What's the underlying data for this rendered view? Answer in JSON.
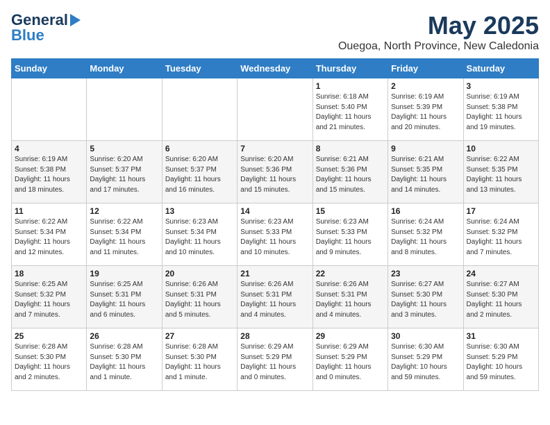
{
  "logo": {
    "line1": "General",
    "line2": "Blue"
  },
  "title": "May 2025",
  "subtitle": "Ouegoa, North Province, New Caledonia",
  "days_of_week": [
    "Sunday",
    "Monday",
    "Tuesday",
    "Wednesday",
    "Thursday",
    "Friday",
    "Saturday"
  ],
  "weeks": [
    [
      {
        "day": "",
        "info": ""
      },
      {
        "day": "",
        "info": ""
      },
      {
        "day": "",
        "info": ""
      },
      {
        "day": "",
        "info": ""
      },
      {
        "day": "1",
        "info": "Sunrise: 6:18 AM\nSunset: 5:40 PM\nDaylight: 11 hours\nand 21 minutes."
      },
      {
        "day": "2",
        "info": "Sunrise: 6:19 AM\nSunset: 5:39 PM\nDaylight: 11 hours\nand 20 minutes."
      },
      {
        "day": "3",
        "info": "Sunrise: 6:19 AM\nSunset: 5:38 PM\nDaylight: 11 hours\nand 19 minutes."
      }
    ],
    [
      {
        "day": "4",
        "info": "Sunrise: 6:19 AM\nSunset: 5:38 PM\nDaylight: 11 hours\nand 18 minutes."
      },
      {
        "day": "5",
        "info": "Sunrise: 6:20 AM\nSunset: 5:37 PM\nDaylight: 11 hours\nand 17 minutes."
      },
      {
        "day": "6",
        "info": "Sunrise: 6:20 AM\nSunset: 5:37 PM\nDaylight: 11 hours\nand 16 minutes."
      },
      {
        "day": "7",
        "info": "Sunrise: 6:20 AM\nSunset: 5:36 PM\nDaylight: 11 hours\nand 15 minutes."
      },
      {
        "day": "8",
        "info": "Sunrise: 6:21 AM\nSunset: 5:36 PM\nDaylight: 11 hours\nand 15 minutes."
      },
      {
        "day": "9",
        "info": "Sunrise: 6:21 AM\nSunset: 5:35 PM\nDaylight: 11 hours\nand 14 minutes."
      },
      {
        "day": "10",
        "info": "Sunrise: 6:22 AM\nSunset: 5:35 PM\nDaylight: 11 hours\nand 13 minutes."
      }
    ],
    [
      {
        "day": "11",
        "info": "Sunrise: 6:22 AM\nSunset: 5:34 PM\nDaylight: 11 hours\nand 12 minutes."
      },
      {
        "day": "12",
        "info": "Sunrise: 6:22 AM\nSunset: 5:34 PM\nDaylight: 11 hours\nand 11 minutes."
      },
      {
        "day": "13",
        "info": "Sunrise: 6:23 AM\nSunset: 5:34 PM\nDaylight: 11 hours\nand 10 minutes."
      },
      {
        "day": "14",
        "info": "Sunrise: 6:23 AM\nSunset: 5:33 PM\nDaylight: 11 hours\nand 10 minutes."
      },
      {
        "day": "15",
        "info": "Sunrise: 6:23 AM\nSunset: 5:33 PM\nDaylight: 11 hours\nand 9 minutes."
      },
      {
        "day": "16",
        "info": "Sunrise: 6:24 AM\nSunset: 5:32 PM\nDaylight: 11 hours\nand 8 minutes."
      },
      {
        "day": "17",
        "info": "Sunrise: 6:24 AM\nSunset: 5:32 PM\nDaylight: 11 hours\nand 7 minutes."
      }
    ],
    [
      {
        "day": "18",
        "info": "Sunrise: 6:25 AM\nSunset: 5:32 PM\nDaylight: 11 hours\nand 7 minutes."
      },
      {
        "day": "19",
        "info": "Sunrise: 6:25 AM\nSunset: 5:31 PM\nDaylight: 11 hours\nand 6 minutes."
      },
      {
        "day": "20",
        "info": "Sunrise: 6:26 AM\nSunset: 5:31 PM\nDaylight: 11 hours\nand 5 minutes."
      },
      {
        "day": "21",
        "info": "Sunrise: 6:26 AM\nSunset: 5:31 PM\nDaylight: 11 hours\nand 4 minutes."
      },
      {
        "day": "22",
        "info": "Sunrise: 6:26 AM\nSunset: 5:31 PM\nDaylight: 11 hours\nand 4 minutes."
      },
      {
        "day": "23",
        "info": "Sunrise: 6:27 AM\nSunset: 5:30 PM\nDaylight: 11 hours\nand 3 minutes."
      },
      {
        "day": "24",
        "info": "Sunrise: 6:27 AM\nSunset: 5:30 PM\nDaylight: 11 hours\nand 2 minutes."
      }
    ],
    [
      {
        "day": "25",
        "info": "Sunrise: 6:28 AM\nSunset: 5:30 PM\nDaylight: 11 hours\nand 2 minutes."
      },
      {
        "day": "26",
        "info": "Sunrise: 6:28 AM\nSunset: 5:30 PM\nDaylight: 11 hours\nand 1 minute."
      },
      {
        "day": "27",
        "info": "Sunrise: 6:28 AM\nSunset: 5:30 PM\nDaylight: 11 hours\nand 1 minute."
      },
      {
        "day": "28",
        "info": "Sunrise: 6:29 AM\nSunset: 5:29 PM\nDaylight: 11 hours\nand 0 minutes."
      },
      {
        "day": "29",
        "info": "Sunrise: 6:29 AM\nSunset: 5:29 PM\nDaylight: 11 hours\nand 0 minutes."
      },
      {
        "day": "30",
        "info": "Sunrise: 6:30 AM\nSunset: 5:29 PM\nDaylight: 10 hours\nand 59 minutes."
      },
      {
        "day": "31",
        "info": "Sunrise: 6:30 AM\nSunset: 5:29 PM\nDaylight: 10 hours\nand 59 minutes."
      }
    ]
  ]
}
